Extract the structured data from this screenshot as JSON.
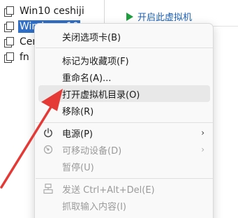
{
  "tree": {
    "items": [
      {
        "label": "Win10 ceshiji",
        "selected": false
      },
      {
        "label": "Windows 10",
        "selected": true
      },
      {
        "label": "Cen",
        "selected": false
      },
      {
        "label": "fn",
        "selected": false
      }
    ]
  },
  "right_panel": {
    "power_on_label": "开启此虚拟机"
  },
  "context_menu": {
    "close_tab": "关闭选项卡(B)",
    "mark_favorite": "标记为收藏项(F)",
    "rename": "重命名(A)...",
    "open_vm_dir": "打开虚拟机目录(O)",
    "remove": "移除(R)",
    "power": "电源(P)",
    "removable_devices": "可移动设备(D)",
    "pause": "暂停(U)",
    "send_ctrl_alt_del": "发送 Ctrl+Alt+Del(E)",
    "grab_input": "抓取输入内容(I)"
  },
  "colors": {
    "selection": "#2f6fc7",
    "hover": "#e8e8e8",
    "annotation_arrow": "#e53935",
    "play_icon": "#1e9e3e",
    "link_text": "#1a5fb4"
  },
  "icons": {
    "vm": "vm-stack-icon",
    "power": "power-icon",
    "removable": "removable-device-icon",
    "send_keys": "keyboard-icon",
    "submenu": "chevron-right-icon",
    "play": "play-icon"
  }
}
